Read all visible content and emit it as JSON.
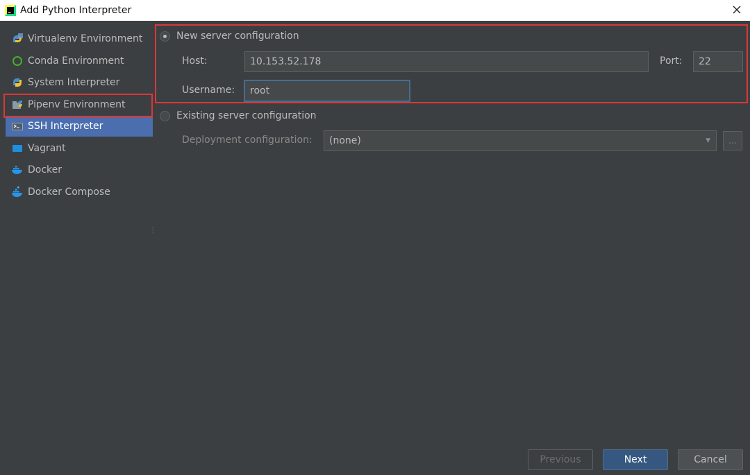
{
  "window": {
    "title": "Add Python Interpreter",
    "app_icon": "pycharm-icon",
    "close_icon": "close-icon"
  },
  "sidebar": {
    "items": [
      {
        "label": "Virtualenv Environment",
        "icon": "virtualenv-icon",
        "selected": false
      },
      {
        "label": "Conda Environment",
        "icon": "conda-icon",
        "selected": false
      },
      {
        "label": "System Interpreter",
        "icon": "python-icon",
        "selected": false
      },
      {
        "label": "Pipenv Environment",
        "icon": "pipenv-icon",
        "selected": false
      },
      {
        "label": "SSH Interpreter",
        "icon": "ssh-icon",
        "selected": true
      },
      {
        "label": "Vagrant",
        "icon": "vagrant-icon",
        "selected": false
      },
      {
        "label": "Docker",
        "icon": "docker-icon",
        "selected": false
      },
      {
        "label": "Docker Compose",
        "icon": "docker-compose-icon",
        "selected": false
      }
    ]
  },
  "new_server": {
    "radio_label": "New server configuration",
    "checked": true,
    "host_label": "Host:",
    "host_value": "10.153.52.178",
    "port_label": "Port:",
    "port_value": "22",
    "username_label": "Username:",
    "username_value": "root"
  },
  "existing_server": {
    "radio_label": "Existing server configuration",
    "checked": false,
    "deployment_label": "Deployment configuration:",
    "deployment_value": "(none)",
    "browse_label": "..."
  },
  "buttons": {
    "previous": "Previous",
    "next": "Next",
    "cancel": "Cancel"
  },
  "colors": {
    "background": "#3c3f41",
    "selection": "#4b6eaf",
    "highlight_box": "#d9383a",
    "next_button": "#365880"
  }
}
